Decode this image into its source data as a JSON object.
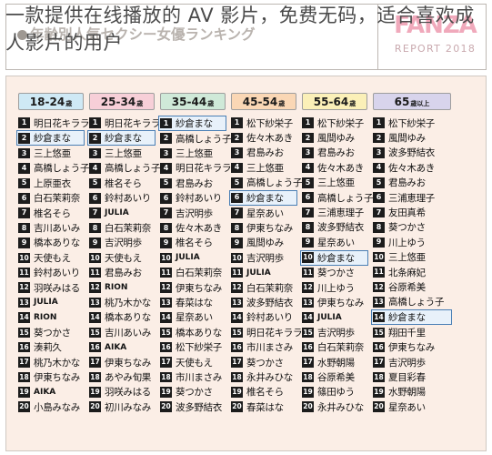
{
  "header": {
    "overlay_caption": "一款提供在线播放的 AV 影片，免费无码，适合喜欢成人影片的用户",
    "background_subtitle": "年齢別人気セクシー女優ランキング",
    "logo_mark": "FANZA",
    "logo_sub": "REPORT 2018"
  },
  "colors": {
    "panel_background": "#fbeee6",
    "highlight_border": "#4a7fb5",
    "highlight_fill": "#e8f1fa",
    "rank_badge": "#1c1c1c",
    "logo_pink": "#f0a9bb"
  },
  "columns": [
    {
      "age_label": "18-24",
      "age_suffix": "歳",
      "pill_color": "#cfe9f5",
      "highlight_rank": 2,
      "items": [
        {
          "rank": "1",
          "name": "明日花キララ",
          "latin": false
        },
        {
          "rank": "2",
          "name": "紗倉まな",
          "latin": false
        },
        {
          "rank": "3",
          "name": "三上悠亜",
          "latin": false
        },
        {
          "rank": "4",
          "name": "高橋しょう子",
          "latin": false
        },
        {
          "rank": "5",
          "name": "上原亜衣",
          "latin": false
        },
        {
          "rank": "6",
          "name": "白石茉莉奈",
          "latin": false
        },
        {
          "rank": "7",
          "name": "椎名そら",
          "latin": false
        },
        {
          "rank": "8",
          "name": "吉川あいみ",
          "latin": false
        },
        {
          "rank": "9",
          "name": "橋本ありな",
          "latin": false
        },
        {
          "rank": "10",
          "name": "天使もえ",
          "latin": false
        },
        {
          "rank": "11",
          "name": "鈴村あいり",
          "latin": false
        },
        {
          "rank": "12",
          "name": "羽咲みはる",
          "latin": false
        },
        {
          "rank": "13",
          "name": "JULIA",
          "latin": true
        },
        {
          "rank": "14",
          "name": "RION",
          "latin": true
        },
        {
          "rank": "15",
          "name": "葵つかさ",
          "latin": false
        },
        {
          "rank": "16",
          "name": "湊莉久",
          "latin": false
        },
        {
          "rank": "17",
          "name": "桃乃木かな",
          "latin": false
        },
        {
          "rank": "18",
          "name": "伊東ちなみ",
          "latin": false
        },
        {
          "rank": "19",
          "name": "AIKA",
          "latin": true
        },
        {
          "rank": "20",
          "name": "小島みなみ",
          "latin": false
        }
      ]
    },
    {
      "age_label": "25-34",
      "age_suffix": "歳",
      "pill_color": "#f7cfd8",
      "highlight_rank": 2,
      "items": [
        {
          "rank": "1",
          "name": "明日花キララ",
          "latin": false
        },
        {
          "rank": "2",
          "name": "紗倉まな",
          "latin": false
        },
        {
          "rank": "3",
          "name": "三上悠亜",
          "latin": false
        },
        {
          "rank": "4",
          "name": "高橋しょう子",
          "latin": false
        },
        {
          "rank": "5",
          "name": "椎名そら",
          "latin": false
        },
        {
          "rank": "6",
          "name": "鈴村あいり",
          "latin": false
        },
        {
          "rank": "7",
          "name": "JULIA",
          "latin": true
        },
        {
          "rank": "8",
          "name": "白石茉莉奈",
          "latin": false
        },
        {
          "rank": "9",
          "name": "吉沢明歩",
          "latin": false
        },
        {
          "rank": "10",
          "name": "天使もえ",
          "latin": false
        },
        {
          "rank": "11",
          "name": "君島みお",
          "latin": false
        },
        {
          "rank": "12",
          "name": "RION",
          "latin": true
        },
        {
          "rank": "13",
          "name": "桃乃木かな",
          "latin": false
        },
        {
          "rank": "14",
          "name": "橋本ありな",
          "latin": false
        },
        {
          "rank": "15",
          "name": "吉川あいみ",
          "latin": false
        },
        {
          "rank": "16",
          "name": "AIKA",
          "latin": true
        },
        {
          "rank": "17",
          "name": "伊東ちなみ",
          "latin": false
        },
        {
          "rank": "18",
          "name": "あやみ旬果",
          "latin": false
        },
        {
          "rank": "19",
          "name": "羽咲みはる",
          "latin": false
        },
        {
          "rank": "20",
          "name": "初川みなみ",
          "latin": false
        }
      ]
    },
    {
      "age_label": "35-44",
      "age_suffix": "歳",
      "pill_color": "#cfe9d8",
      "highlight_rank": 1,
      "items": [
        {
          "rank": "1",
          "name": "紗倉まな",
          "latin": false
        },
        {
          "rank": "2",
          "name": "高橋しょう子",
          "latin": false
        },
        {
          "rank": "3",
          "name": "三上悠亜",
          "latin": false
        },
        {
          "rank": "4",
          "name": "明日花キララ",
          "latin": false
        },
        {
          "rank": "5",
          "name": "君島みお",
          "latin": false
        },
        {
          "rank": "6",
          "name": "鈴村あいり",
          "latin": false
        },
        {
          "rank": "7",
          "name": "吉沢明歩",
          "latin": false
        },
        {
          "rank": "8",
          "name": "佐々木あき",
          "latin": false
        },
        {
          "rank": "9",
          "name": "椎名そら",
          "latin": false
        },
        {
          "rank": "10",
          "name": "JULIA",
          "latin": true
        },
        {
          "rank": "11",
          "name": "白石茉莉奈",
          "latin": false
        },
        {
          "rank": "12",
          "name": "伊東ちなみ",
          "latin": false
        },
        {
          "rank": "13",
          "name": "春菜はな",
          "latin": false
        },
        {
          "rank": "14",
          "name": "星奈あい",
          "latin": false
        },
        {
          "rank": "15",
          "name": "橋本ありな",
          "latin": false
        },
        {
          "rank": "16",
          "name": "松下紗栄子",
          "latin": false
        },
        {
          "rank": "17",
          "name": "天使もえ",
          "latin": false
        },
        {
          "rank": "18",
          "name": "市川まさみ",
          "latin": false
        },
        {
          "rank": "19",
          "name": "葵つかさ",
          "latin": false
        },
        {
          "rank": "20",
          "name": "波多野結衣",
          "latin": false
        }
      ]
    },
    {
      "age_label": "45-54",
      "age_suffix": "歳",
      "pill_color": "#fad7b5",
      "highlight_rank": 6,
      "items": [
        {
          "rank": "1",
          "name": "松下紗栄子",
          "latin": false
        },
        {
          "rank": "2",
          "name": "佐々木あき",
          "latin": false
        },
        {
          "rank": "3",
          "name": "君島みお",
          "latin": false
        },
        {
          "rank": "4",
          "name": "三上悠亜",
          "latin": false
        },
        {
          "rank": "5",
          "name": "高橋しょう子",
          "latin": false
        },
        {
          "rank": "6",
          "name": "紗倉まな",
          "latin": false
        },
        {
          "rank": "7",
          "name": "星奈あい",
          "latin": false
        },
        {
          "rank": "8",
          "name": "伊東ちなみ",
          "latin": false
        },
        {
          "rank": "9",
          "name": "風間ゆみ",
          "latin": false
        },
        {
          "rank": "10",
          "name": "吉沢明歩",
          "latin": false
        },
        {
          "rank": "11",
          "name": "JULIA",
          "latin": true
        },
        {
          "rank": "12",
          "name": "白石茉莉奈",
          "latin": false
        },
        {
          "rank": "13",
          "name": "波多野結衣",
          "latin": false
        },
        {
          "rank": "14",
          "name": "鈴村あいり",
          "latin": false
        },
        {
          "rank": "15",
          "name": "明日花キララ",
          "latin": false
        },
        {
          "rank": "16",
          "name": "市川まさみ",
          "latin": false
        },
        {
          "rank": "17",
          "name": "葵つかさ",
          "latin": false
        },
        {
          "rank": "18",
          "name": "永井みひな",
          "latin": false
        },
        {
          "rank": "19",
          "name": "椎名そら",
          "latin": false
        },
        {
          "rank": "20",
          "name": "春菜はな",
          "latin": false
        }
      ]
    },
    {
      "age_label": "55-64",
      "age_suffix": "歳",
      "pill_color": "#fbf0b8",
      "highlight_rank": 10,
      "items": [
        {
          "rank": "1",
          "name": "松下紗栄子",
          "latin": false
        },
        {
          "rank": "2",
          "name": "風間ゆみ",
          "latin": false
        },
        {
          "rank": "3",
          "name": "君島みお",
          "latin": false
        },
        {
          "rank": "4",
          "name": "佐々木あき",
          "latin": false
        },
        {
          "rank": "5",
          "name": "三上悠亜",
          "latin": false
        },
        {
          "rank": "6",
          "name": "高橋しょう子",
          "latin": false
        },
        {
          "rank": "7",
          "name": "三浦恵理子",
          "latin": false
        },
        {
          "rank": "8",
          "name": "波多野結衣",
          "latin": false
        },
        {
          "rank": "9",
          "name": "星奈あい",
          "latin": false
        },
        {
          "rank": "10",
          "name": "紗倉まな",
          "latin": false
        },
        {
          "rank": "11",
          "name": "葵つかさ",
          "latin": false
        },
        {
          "rank": "12",
          "name": "川上ゆう",
          "latin": false
        },
        {
          "rank": "13",
          "name": "伊東ちなみ",
          "latin": false
        },
        {
          "rank": "14",
          "name": "JULIA",
          "latin": true
        },
        {
          "rank": "15",
          "name": "吉沢明歩",
          "latin": false
        },
        {
          "rank": "16",
          "name": "白石茉莉奈",
          "latin": false
        },
        {
          "rank": "17",
          "name": "水野朝陽",
          "latin": false
        },
        {
          "rank": "18",
          "name": "谷原希美",
          "latin": false
        },
        {
          "rank": "19",
          "name": "篠田ゆう",
          "latin": false
        },
        {
          "rank": "20",
          "name": "永井みひな",
          "latin": false
        }
      ]
    },
    {
      "age_label": "65",
      "age_suffix": "歳以上",
      "pill_color": "#d8d4ec",
      "highlight_rank": 14,
      "items": [
        {
          "rank": "1",
          "name": "松下紗栄子",
          "latin": false
        },
        {
          "rank": "2",
          "name": "風間ゆみ",
          "latin": false
        },
        {
          "rank": "3",
          "name": "波多野結衣",
          "latin": false
        },
        {
          "rank": "4",
          "name": "佐々木あき",
          "latin": false
        },
        {
          "rank": "5",
          "name": "君島みお",
          "latin": false
        },
        {
          "rank": "6",
          "name": "三浦恵理子",
          "latin": false
        },
        {
          "rank": "7",
          "name": "友田真希",
          "latin": false
        },
        {
          "rank": "8",
          "name": "葵つかさ",
          "latin": false
        },
        {
          "rank": "9",
          "name": "川上ゆう",
          "latin": false
        },
        {
          "rank": "10",
          "name": "三上悠亜",
          "latin": false
        },
        {
          "rank": "11",
          "name": "北条麻妃",
          "latin": false
        },
        {
          "rank": "12",
          "name": "谷原希美",
          "latin": false
        },
        {
          "rank": "13",
          "name": "高橋しょう子",
          "latin": false
        },
        {
          "rank": "14",
          "name": "紗倉まな",
          "latin": false
        },
        {
          "rank": "15",
          "name": "翔田千里",
          "latin": false
        },
        {
          "rank": "16",
          "name": "伊東ちなみ",
          "latin": false
        },
        {
          "rank": "17",
          "name": "吉沢明歩",
          "latin": false
        },
        {
          "rank": "18",
          "name": "夏目彩春",
          "latin": false
        },
        {
          "rank": "19",
          "name": "水野朝陽",
          "latin": false
        },
        {
          "rank": "20",
          "name": "星奈あい",
          "latin": false
        }
      ]
    }
  ]
}
